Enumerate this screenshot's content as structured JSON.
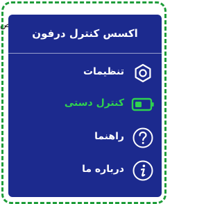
{
  "background_text": "ص",
  "menu": {
    "title": "اکسس کنترل درفون",
    "items": [
      {
        "label": "تنظیمات",
        "icon": "settings-hexagon-icon",
        "active": false
      },
      {
        "label": "کنترل دستی",
        "icon": "battery-toggle-icon",
        "active": true
      },
      {
        "label": "راهنما",
        "icon": "help-question-icon",
        "active": false
      },
      {
        "label": "درباره ما",
        "icon": "info-icon",
        "active": false
      }
    ]
  },
  "colors": {
    "panel": "#1c2a8e",
    "text": "#ffffff",
    "active": "#2fd24f",
    "frame": "#1f9d3a"
  }
}
